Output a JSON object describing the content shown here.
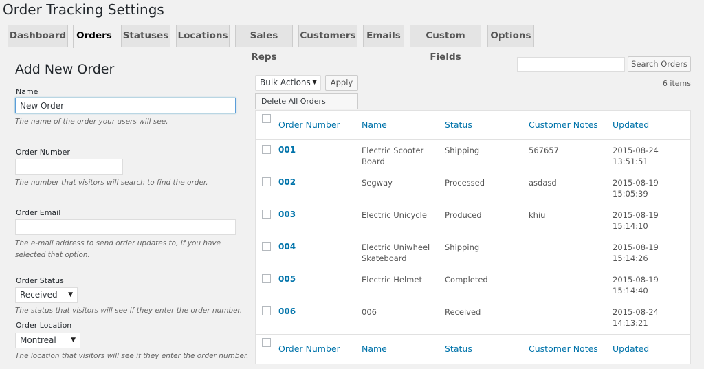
{
  "page_title": "Order Tracking Settings",
  "tabs": [
    {
      "label": "Dashboard"
    },
    {
      "label": "Orders",
      "active": true
    },
    {
      "label": "Statuses"
    },
    {
      "label": "Locations"
    },
    {
      "label": "Sales Reps"
    },
    {
      "label": "Customers"
    },
    {
      "label": "Emails"
    },
    {
      "label": "Custom Fields"
    },
    {
      "label": "Options"
    }
  ],
  "form": {
    "title": "Add New Order",
    "name": {
      "label": "Name",
      "value": "New Order",
      "description": "The name of the order your users will see."
    },
    "order_number": {
      "label": "Order Number",
      "value": "",
      "description": "The number that visitors will search to find the order."
    },
    "order_email": {
      "label": "Order Email",
      "value": "",
      "description": "The e-mail address to send order updates to, if you have selected that option."
    },
    "order_status": {
      "label": "Order Status",
      "value": "Received",
      "description": "The status that visitors will see if they enter the order number."
    },
    "order_location": {
      "label": "Order Location",
      "value": "Montreal",
      "description": "The location that visitors will see if they enter the order number."
    }
  },
  "list": {
    "search_button": "Search Orders",
    "bulk_actions": "Bulk Actions",
    "apply_button": "Apply",
    "bulk_option": "Delete All Orders",
    "items_count": "6 items",
    "columns": [
      "Order Number",
      "Name",
      "Status",
      "Customer Notes",
      "Updated"
    ],
    "rows": [
      {
        "number": "001",
        "name": "Electric Scooter Board",
        "status": "Shipping",
        "notes": "567657",
        "updated": "2015-08-24 13:51:51"
      },
      {
        "number": "002",
        "name": "Segway",
        "status": "Processed",
        "notes": "asdasd",
        "updated": "2015-08-19 15:05:39"
      },
      {
        "number": "003",
        "name": "Electric Unicycle",
        "status": "Produced",
        "notes": "khiu",
        "updated": "2015-08-19 15:14:10"
      },
      {
        "number": "004",
        "name": "Electric Uniwheel Skateboard",
        "status": "Shipping",
        "notes": "",
        "updated": "2015-08-19 15:14:26"
      },
      {
        "number": "005",
        "name": "Electric Helmet",
        "status": "Completed",
        "notes": "",
        "updated": "2015-08-19 15:14:40"
      },
      {
        "number": "006",
        "name": "006",
        "status": "Received",
        "notes": "",
        "updated": "2015-08-24 14:13:21"
      }
    ]
  },
  "icons": {
    "dropdown_arrow": "▼"
  }
}
